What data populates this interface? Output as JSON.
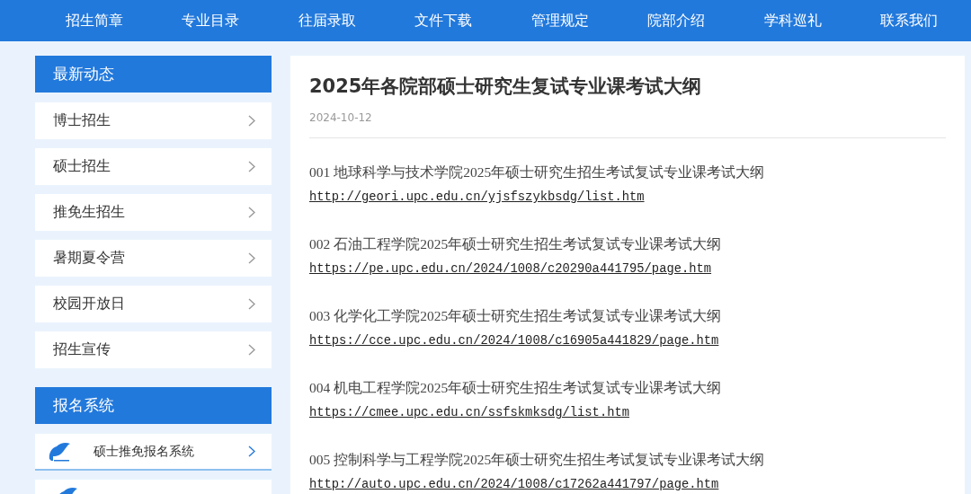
{
  "nav": [
    "招生简章",
    "专业目录",
    "往届录取",
    "文件下载",
    "管理规定",
    "院部介绍",
    "学科巡礼",
    "联系我们"
  ],
  "sidebar": [
    {
      "title": "最新动态",
      "kind": "news",
      "items": [
        {
          "label": "博士招生",
          "kind": "link"
        },
        {
          "label": "硕士招生",
          "kind": "link"
        },
        {
          "label": "推免生招生",
          "kind": "link"
        },
        {
          "label": "暑期夏令营",
          "kind": "link"
        },
        {
          "label": "校园开放日",
          "kind": "link"
        },
        {
          "label": "招生宣传",
          "kind": "link"
        }
      ]
    },
    {
      "title": "报名系统",
      "kind": "system",
      "items": [
        {
          "label": "硕士推免报名系统",
          "kind": "link"
        },
        {
          "kind": "partial"
        }
      ]
    }
  ],
  "article": {
    "title": "2025年各院部硕士研究生复试专业课考试大纲",
    "date": "2024-10-12",
    "entries": [
      {
        "text": "001 地球科学与技术学院2025年硕士研究生招生考试复试专业课考试大纲",
        "url": "http://geori.upc.edu.cn/yjsfszykbsdg/list.htm"
      },
      {
        "text": "002 石油工程学院2025年硕士研究生招生考试复试专业课考试大纲",
        "url": "https://pe.upc.edu.cn/2024/1008/c20290a441795/page.htm"
      },
      {
        "text": "003 化学化工学院2025年硕士研究生招生考试复试专业课考试大纲",
        "url": "https://cce.upc.edu.cn/2024/1008/c16905a441829/page.htm"
      },
      {
        "text": "004 机电工程学院2025年硕士研究生招生考试复试专业课考试大纲",
        "url": "https://cmee.upc.edu.cn/ssfskmksdg/list.htm"
      },
      {
        "text": "005 控制科学与工程学院2025年硕士研究生招生考试复试专业课考试大纲",
        "url": "http://auto.upc.edu.cn/2024/1008/c17262a441797/page.htm"
      }
    ]
  }
}
